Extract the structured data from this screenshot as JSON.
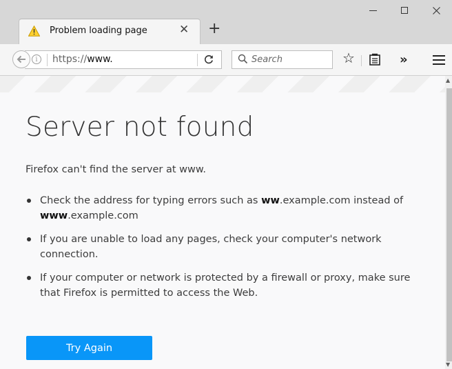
{
  "tab": {
    "title": "Problem loading page",
    "close_label": "✕",
    "icon": "warning-icon"
  },
  "newtab_label": "+",
  "window": {
    "minimize": "minimize-icon",
    "maximize": "maximize-icon",
    "close": "close-icon"
  },
  "nav": {
    "url_prefix": "https://",
    "url_host": "www.",
    "info_glyph": "i",
    "reload_glyph": "C",
    "search_placeholder": "Search",
    "bookmark_star": "☆",
    "overflow_label": "»"
  },
  "content": {
    "heading": "Server not found",
    "description": "Firefox can't find the server at www.",
    "tips": [
      {
        "pre": "Check the address for typing errors such as ",
        "b1": "ww",
        "mid": ".example.com instead of ",
        "b2": "www",
        "post": ".example.com"
      },
      {
        "text": "If you are unable to load any pages, check your computer's network connection."
      },
      {
        "text": "If your computer or network is protected by a firewall or proxy, make sure that Firefox is permitted to access the Web."
      }
    ],
    "try_again_label": "Try Again"
  },
  "colors": {
    "accent": "#0996f8",
    "warning": "#ffd130"
  }
}
